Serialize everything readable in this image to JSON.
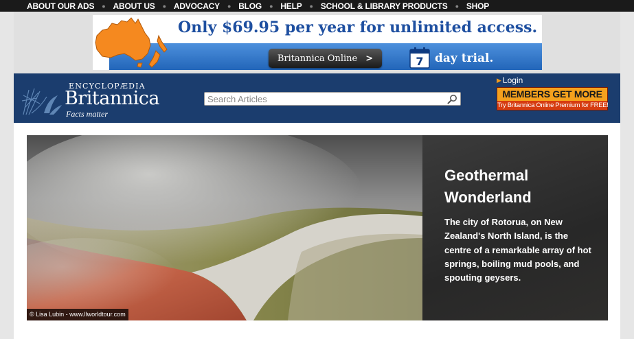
{
  "topnav": {
    "items": [
      "ABOUT OUR ADS",
      "ABOUT US",
      "ADVOCACY",
      "BLOG",
      "HELP",
      "SCHOOL & LIBRARY PRODUCTS",
      "SHOP"
    ]
  },
  "ad": {
    "headline": "Only $69.95 per year for unlimited access.",
    "cta_label": "Britannica Online",
    "cta_arrow": ">",
    "calendar_number": "7",
    "trial_text": "day trial."
  },
  "header": {
    "logo_top": "ENCYCLOPÆDIA",
    "logo_name": "Britannica",
    "logo_tagline": "Facts matter",
    "search_placeholder": "Search Articles",
    "login_label": "Login",
    "members_title": "MEMBERS GET MORE",
    "members_subtitle": "Try Britannica Online Premium for FREE!"
  },
  "hero": {
    "title": "Geothermal Wonderland",
    "description": "The city of Rotorua, on New Zealand's North Island, is the centre of a remarkable array of hot springs, boiling mud pools, and spouting geysers.",
    "photo_credit": "© Lisa Lubin - www.llworldtour.com"
  },
  "colors": {
    "header_bg": "#1b3d6e",
    "topnav_bg": "#1a1a1a",
    "ad_blue": "#1f62b6",
    "members_orange": "#f5a11d",
    "members_red": "#d63c10",
    "map_orange": "#f5891f"
  },
  "icons": {
    "search": "magnifier-icon",
    "login": "triangle-right-icon",
    "calendar": "calendar-icon",
    "emblem": "thistle-emblem"
  }
}
